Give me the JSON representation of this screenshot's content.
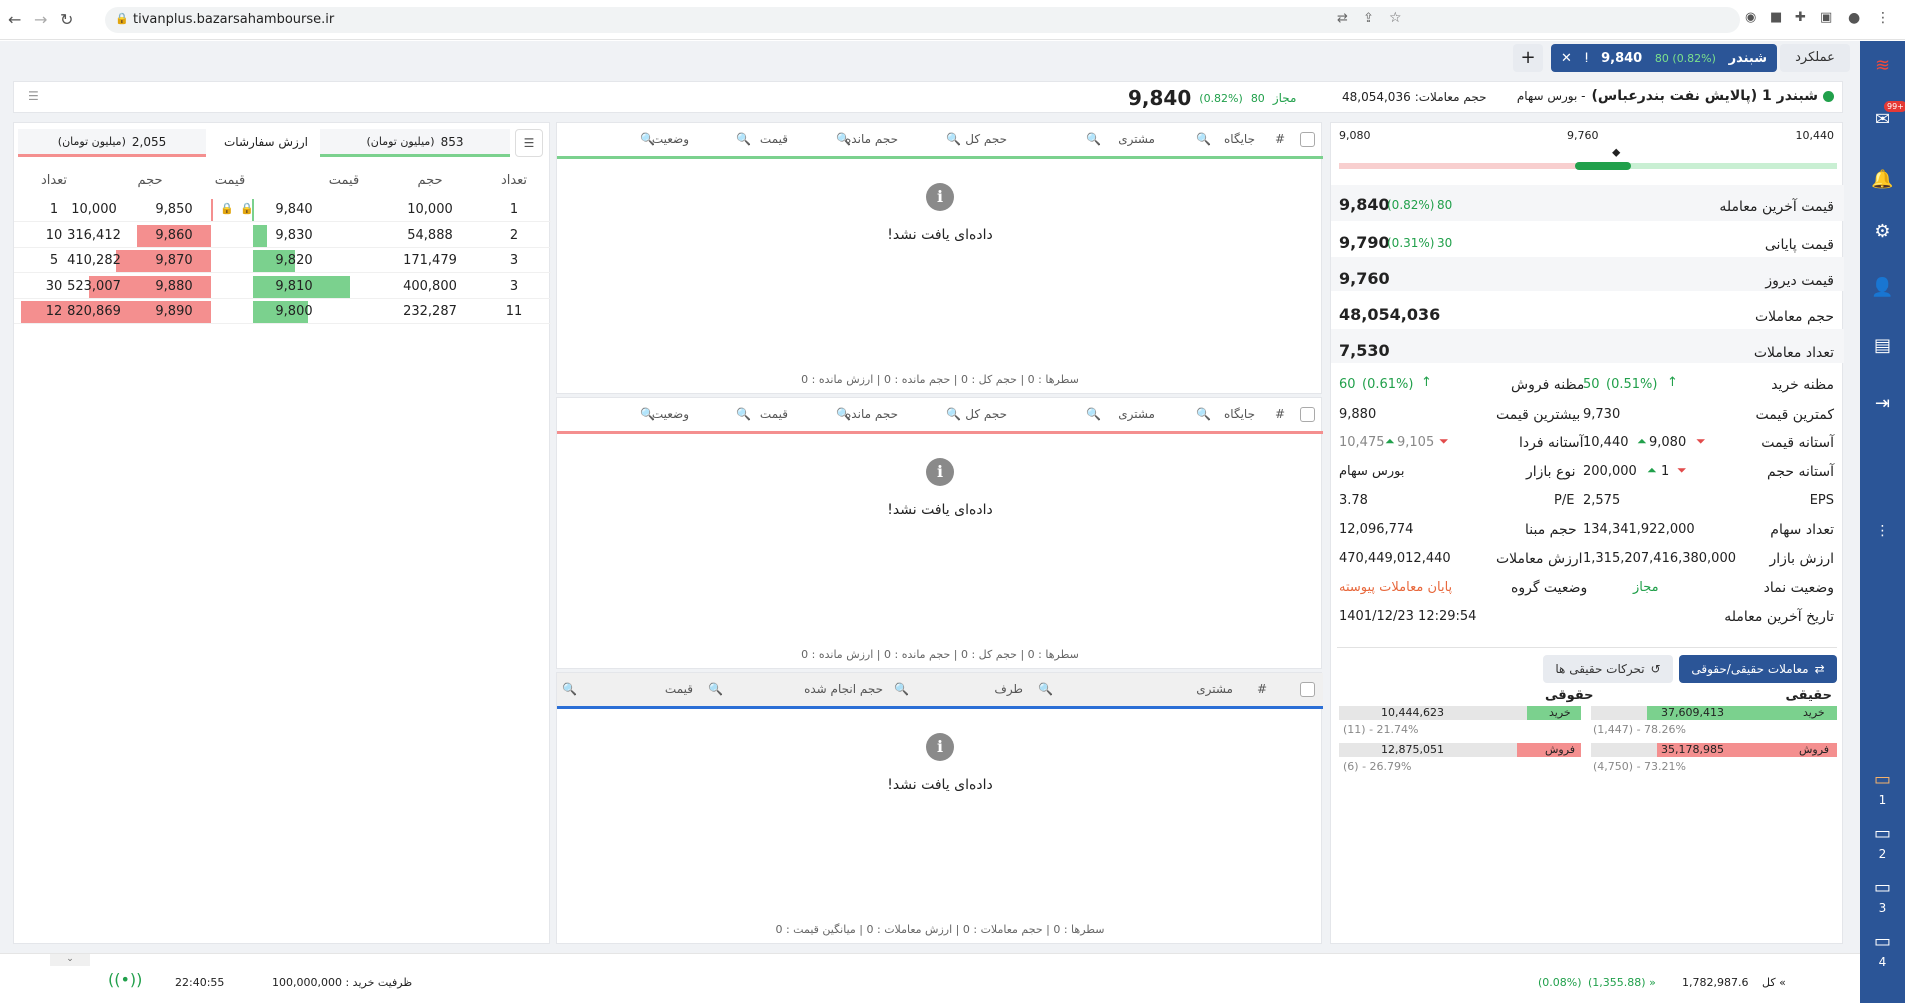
{
  "browser": {
    "url": "tivanplus.bazarsahambourse.ir"
  },
  "tabs": {
    "workflow": "عملکرد",
    "active_symbol": "شبندر",
    "active_change": "(0.82%) 80",
    "active_price": "9,840",
    "add": "+"
  },
  "header": {
    "symbol_title": "شبندر 1 (پالایش نفت بندرعباس)",
    "market": "- بورس سهام",
    "volume_label": "حجم معاملات:",
    "volume_value": "48,054,036",
    "status": "مجاز",
    "change_abs": "80",
    "change_pct": "(0.82%)",
    "last_price": "9,840"
  },
  "range": {
    "max": "10,440",
    "mid": "9,760",
    "min": "9,080"
  },
  "info": {
    "last_trade_label": "قیمت آخرین معامله",
    "last_trade_price": "9,840",
    "last_trade_change": "(0.82%)",
    "last_trade_abs": "80",
    "closing_label": "قیمت پایانی",
    "closing_price": "9,790",
    "closing_change": "(0.31%)",
    "closing_abs": "30",
    "yesterday_label": "قیمت دیروز",
    "yesterday_price": "9,760",
    "volume_label": "حجم معاملات",
    "volume": "48,054,036",
    "count_label": "تعداد معاملات",
    "count": "7,530",
    "buy_suspect_label": "مظنه خرید",
    "buy_suspect_abs": "50",
    "buy_suspect_pct": "(0.51%)",
    "sell_suspect_label": "مظنه فروش",
    "sell_suspect_abs": "60",
    "sell_suspect_pct": "(0.61%)",
    "min_label": "کمترین قیمت",
    "min_value": "9,730",
    "max_label": "بیشترین قیمت",
    "max_value": "9,880",
    "price_limit_label": "آستانه قیمت",
    "price_limit_high": "10,440",
    "price_limit_low": "9,080",
    "tomorrow_limit_label": "آستانه فردا",
    "tomorrow_limit_high": "10,475",
    "tomorrow_limit_low": "9,105",
    "volume_limit_label": "آستانه حجم",
    "volume_limit_high": "200,000",
    "volume_limit_low": "1",
    "market_type_label": "نوع بازار",
    "market_type": "بورس سهام",
    "eps_label": "EPS",
    "eps": "2,575",
    "pe_label": "P/E",
    "pe": "3.78",
    "shares_label": "تعداد سهام",
    "shares": "134,341,922,000",
    "base_vol_label": "حجم مبنا",
    "base_vol": "12,096,774",
    "mkt_value_label": "ارزش بازار",
    "mkt_value": "1,315,207,416,380,000",
    "trade_value_label": "ارزش معاملات",
    "trade_value": "470,449,012,440",
    "symbol_status_label": "وضعیت نماد",
    "symbol_status": "مجاز",
    "group_status_label": "وضعیت گروه",
    "group_status": "پایان معاملات پیوسته",
    "last_date_label": "تاریخ آخرین معامله",
    "last_date": "1401/12/23 12:29:54"
  },
  "legal": {
    "tab_active": "معاملات حقیقی/حقوقی",
    "tab_other": "تحرکات حقیقی ها",
    "real_label": "حقیقی",
    "legal_label": "حقوقی",
    "buy": "خرید",
    "sell": "فروش",
    "real_buy": "37,609,413",
    "real_buy_sub": "(1,447) - 78.26%",
    "real_sell": "35,178,985",
    "real_sell_sub": "(4,750) - 73.21%",
    "legal_buy": "10,444,623",
    "legal_buy_sub": "(11) - 21.74%",
    "legal_sell": "12,875,051",
    "legal_sell_sub": "(6) - 26.79%"
  },
  "orders_table": {
    "headers": [
      "#",
      "جایگاه",
      "مشتری",
      "حجم کل",
      "حجم مانده",
      "قیمت",
      "وضعیت"
    ],
    "empty": "داده‌ای یافت نشد!",
    "footer": "سطرها : 0 | حجم کل : 0 | حجم مانده : 0 | ارزش مانده : 0"
  },
  "trades_table": {
    "headers": [
      "#",
      "مشتری",
      "طرف",
      "حجم انجام شده",
      "قیمت"
    ],
    "empty": "داده‌ای یافت نشد!",
    "footer": "سطرها : 0 | حجم معاملات : 0 | ارزش معاملات : 0 | میانگین قیمت : 0"
  },
  "orderbook": {
    "buy_value": "853",
    "buy_unit": "(میلیون تومان)",
    "value_label": "ارزش سفارشات",
    "sell_value": "2,055",
    "sell_unit": "(میلیون تومان)",
    "headers": {
      "count": "تعداد",
      "volume": "حجم",
      "price": "قیمت"
    },
    "rows": [
      {
        "bc": "1",
        "bv": "10,000",
        "bp": "9,840",
        "sp": "9,850",
        "sv": "10,000",
        "sc": "1",
        "bfill": 0,
        "sfill": 0
      },
      {
        "bc": "2",
        "bv": "54,888",
        "bp": "9,830",
        "sp": "9,860",
        "sv": "316,412",
        "sc": "10",
        "bfill": 0.07,
        "sfill": 0.39
      },
      {
        "bc": "3",
        "bv": "171,479",
        "bp": "9,820",
        "sp": "9,870",
        "sv": "410,282",
        "sc": "5",
        "bfill": 0.21,
        "sfill": 0.5
      },
      {
        "bc": "3",
        "bv": "400,800",
        "bp": "9,810",
        "sp": "9,880",
        "sv": "523,007",
        "sc": "30",
        "bfill": 0.49,
        "sfill": 0.64
      },
      {
        "bc": "11",
        "bv": "232,287",
        "bp": "9,800",
        "sp": "9,890",
        "sv": "820,869",
        "sc": "12",
        "bfill": 0.28,
        "sfill": 1
      }
    ]
  },
  "status": {
    "index_label": "» کل",
    "index_value": "1,782,987.6",
    "index_change": "(1,355.88) »",
    "index_pct": "(0.08%)",
    "buy_capacity": "ظرفیت خرید : 100,000,000",
    "time": "22:40:55"
  },
  "sidebar": {
    "m1": "1",
    "m2": "2",
    "m3": "3",
    "m4": "4",
    "badge": "99+"
  }
}
